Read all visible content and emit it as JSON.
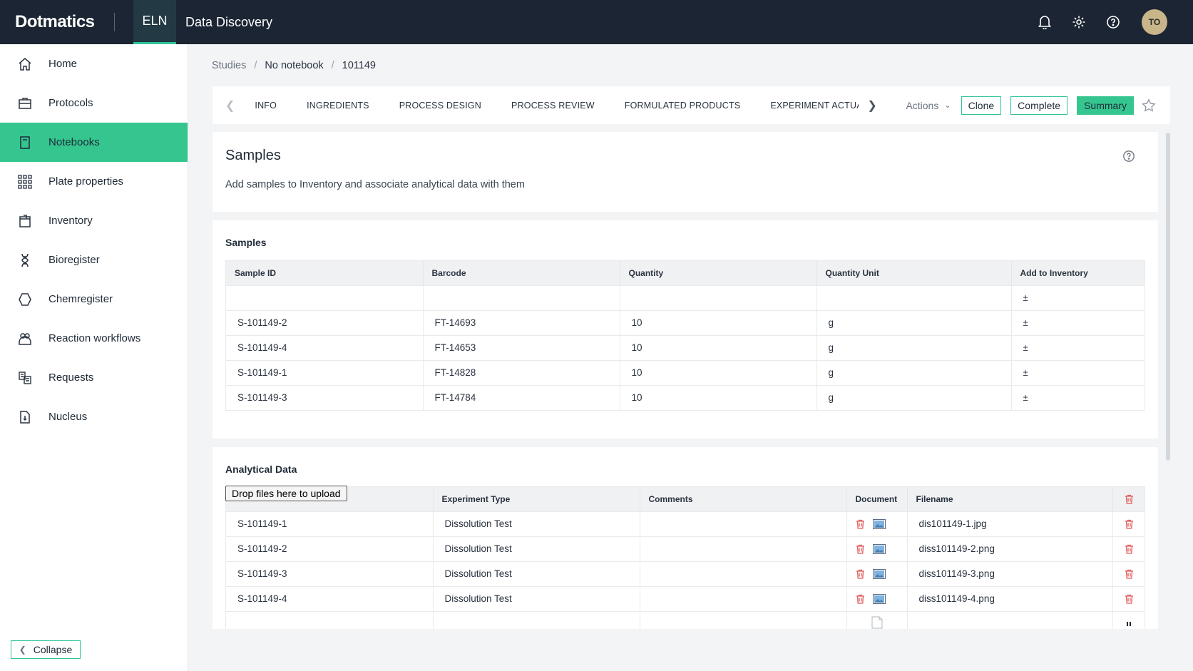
{
  "topbar": {
    "logo": "Dotmatics",
    "tab_eln": "ELN",
    "tab_data_discovery": "Data Discovery",
    "avatar_initials": "TO"
  },
  "sidebar": {
    "items": [
      {
        "label": "Home",
        "icon": "home-icon"
      },
      {
        "label": "Protocols",
        "icon": "briefcase-icon"
      },
      {
        "label": "Notebooks",
        "icon": "notebook-icon",
        "active": true
      },
      {
        "label": "Plate properties",
        "icon": "grid-icon"
      },
      {
        "label": "Inventory",
        "icon": "box-icon"
      },
      {
        "label": "Bioregister",
        "icon": "dna-icon"
      },
      {
        "label": "Chemregister",
        "icon": "hexagon-icon"
      },
      {
        "label": "Reaction workflows",
        "icon": "users-icon"
      },
      {
        "label": "Requests",
        "icon": "requests-icon"
      },
      {
        "label": "Nucleus",
        "icon": "document-icon"
      }
    ],
    "collapse_label": "Collapse"
  },
  "breadcrumb": [
    "Studies",
    "No notebook",
    "101149"
  ],
  "tabs": [
    "INFO",
    "INGREDIENTS",
    "PROCESS DESIGN",
    "PROCESS REVIEW",
    "FORMULATED PRODUCTS",
    "EXPERIMENT ACTUAL"
  ],
  "tab_actions": {
    "actions_label": "Actions",
    "clone_label": "Clone",
    "complete_label": "Complete",
    "summary_label": "Summary"
  },
  "header_card": {
    "title": "Samples",
    "subtitle": "Add samples to Inventory and associate analytical data with them"
  },
  "samples": {
    "title": "Samples",
    "columns": [
      "Sample ID",
      "Barcode",
      "Quantity",
      "Quantity Unit",
      "Add to Inventory"
    ],
    "rows": [
      [
        "",
        "",
        "",
        "",
        "±"
      ],
      [
        "S-101149-2",
        "FT-14693",
        "10",
        "g",
        "±"
      ],
      [
        "S-101149-4",
        "FT-14653",
        "10",
        "g",
        "±"
      ],
      [
        "S-101149-1",
        "FT-14828",
        "10",
        "g",
        "±"
      ],
      [
        "S-101149-3",
        "FT-14784",
        "10",
        "g",
        "±"
      ]
    ]
  },
  "analytical": {
    "title": "Analytical Data",
    "drop_label": "Drop files here to upload",
    "columns": [
      "",
      "Experiment Type",
      "Comments",
      "Document",
      "Filename",
      ""
    ],
    "rows": [
      [
        "S-101149-1",
        "Dissolution Test",
        "",
        "",
        "dis101149-1.jpg"
      ],
      [
        "S-101149-2",
        "Dissolution Test",
        "",
        "",
        "diss101149-2.png"
      ],
      [
        "S-101149-3",
        "Dissolution Test",
        "",
        "",
        "diss101149-3.png"
      ],
      [
        "S-101149-4",
        "Dissolution Test",
        "",
        "",
        "diss101149-4.png"
      ]
    ]
  },
  "colors": {
    "accent": "#35c690",
    "topbar": "#1b2533",
    "danger": "#e05a5a"
  }
}
